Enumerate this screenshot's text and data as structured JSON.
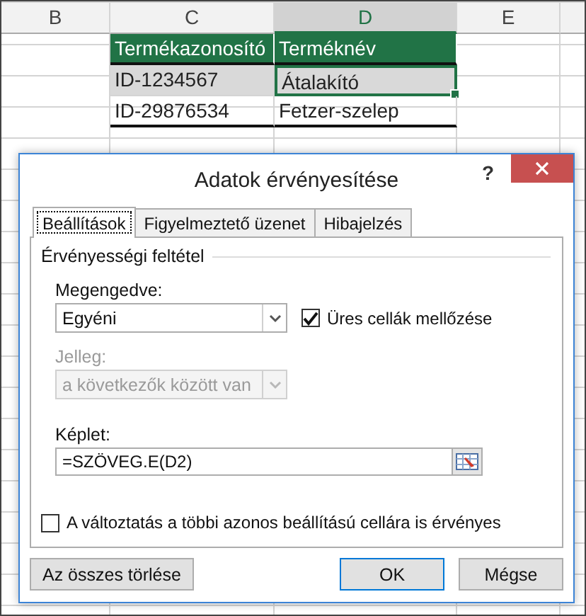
{
  "sheet": {
    "columns": [
      {
        "label": "B",
        "selected": false
      },
      {
        "label": "C",
        "selected": false
      },
      {
        "label": "D",
        "selected": true
      },
      {
        "label": "E",
        "selected": false
      }
    ],
    "table": {
      "header": [
        "Termékazonosító",
        "Terméknév"
      ],
      "rows": [
        {
          "id": "ID-1234567",
          "name": "Átalakító",
          "selected": true
        },
        {
          "id": "ID-29876534",
          "name": "Fetzer-szelep",
          "selected": false
        }
      ]
    }
  },
  "dialog": {
    "title": "Adatok érvényesítése",
    "help": "?",
    "tabs": [
      {
        "label": "Beállítások",
        "selected": true
      },
      {
        "label": "Figyelmeztető üzenet",
        "selected": false
      },
      {
        "label": "Hibajelzés",
        "selected": false
      }
    ],
    "group": "Érvényességi feltétel",
    "allow": {
      "label": "Megengedve:",
      "value": "Egyéni",
      "disabled": false
    },
    "ignore_blank": {
      "label": "Üres cellák mellőzése",
      "checked": true
    },
    "data": {
      "label": "Jelleg:",
      "value": "a következők között van",
      "disabled": true
    },
    "formula": {
      "label": "Képlet:",
      "value": "=SZÖVEG.E(D2)"
    },
    "apply_all": {
      "label": "A változtatás a többi azonos beállítású cellára is érvényes",
      "checked": false
    },
    "buttons": [
      {
        "label": "Az összes törlése",
        "default": false,
        "kind": "left"
      },
      {
        "label": "OK",
        "default": true,
        "kind": "right"
      },
      {
        "label": "Mégse",
        "default": false,
        "kind": "right"
      }
    ]
  }
}
